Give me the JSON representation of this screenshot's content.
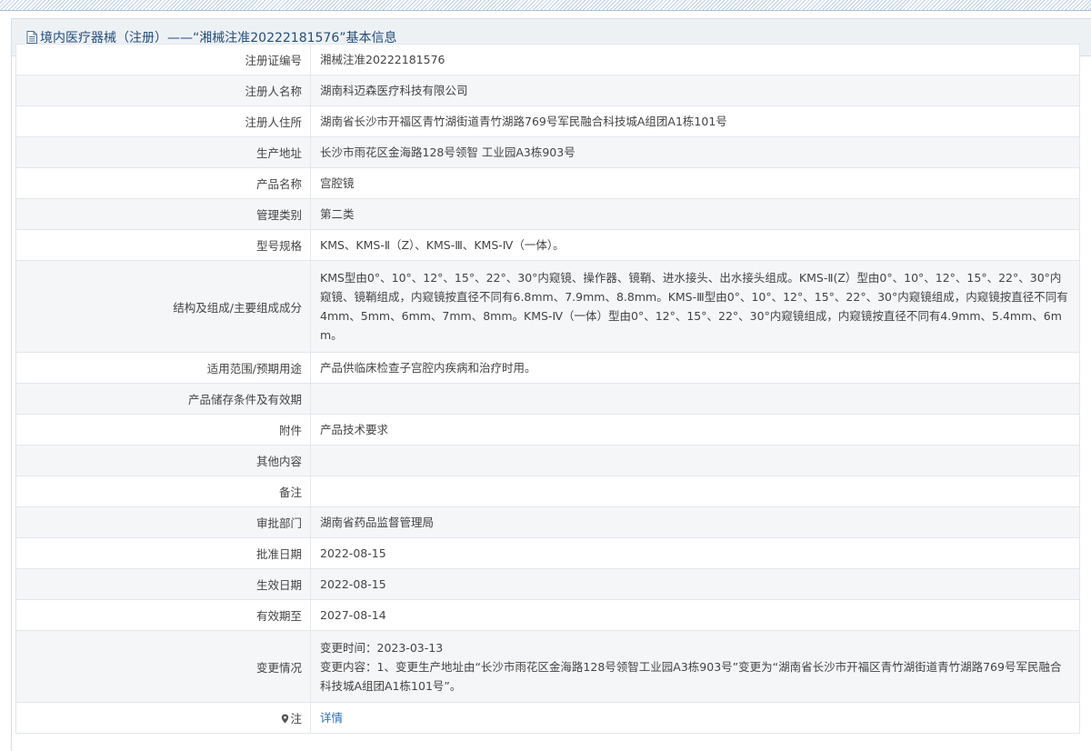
{
  "header": {
    "title": "境内医疗器械（注册）——“湘械注准20222181576”基本信息"
  },
  "rows": [
    {
      "label": "注册证编号",
      "value": "湘械注准20222181576"
    },
    {
      "label": "注册人名称",
      "value": "湖南科迈森医疗科技有限公司"
    },
    {
      "label": "注册人住所",
      "value": "湖南省长沙市开福区青竹湖街道青竹湖路769号军民融合科技城A组团A1栋101号"
    },
    {
      "label": "生产地址",
      "value": "长沙市雨花区金海路128号领智 工业园A3栋903号"
    },
    {
      "label": "产品名称",
      "value": "宫腔镜"
    },
    {
      "label": "管理类别",
      "value": "第二类"
    },
    {
      "label": "型号规格",
      "value": "KMS、KMS-Ⅱ（Z）、KMS-Ⅲ、KMS-Ⅳ（一体）。"
    },
    {
      "label": "结构及组成/主要组成成分",
      "value": "KMS型由0°、10°、12°、15°、22°、30°内窥镜、操作器、镜鞘、进水接头、出水接头组成。KMS-Ⅱ(Z）型由0°、10°、12°、15°、22°、30°内窥镜、镜鞘组成，内窥镜按直径不同有6.8mm、7.9mm、8.8mm。KMS-Ⅲ型由0°、10°、12°、15°、22°、30°内窥镜组成，内窥镜按直径不同有4mm、5mm、6mm、7mm、8mm。KMS-Ⅳ（一体）型由0°、12°、15°、22°、30°内窥镜组成，内窥镜按直径不同有4.9mm、5.4mm、6mm。"
    },
    {
      "label": "适用范围/预期用途",
      "value": "产品供临床检查子宫腔内疾病和治疗时用。"
    },
    {
      "label": "产品储存条件及有效期",
      "value": ""
    },
    {
      "label": "附件",
      "value": "产品技术要求"
    },
    {
      "label": "其他内容",
      "value": ""
    },
    {
      "label": "备注",
      "value": ""
    },
    {
      "label": "审批部门",
      "value": "湖南省药品监督管理局"
    },
    {
      "label": "批准日期",
      "value": "2022-08-15"
    },
    {
      "label": "生效日期",
      "value": "2022-08-15"
    },
    {
      "label": "有效期至",
      "value": "2027-08-14"
    }
  ],
  "change": {
    "label": "变更情况",
    "time": "变更时间：2023-03-13",
    "content": "变更内容：1、变更生产地址由“长沙市雨花区金海路128号领智工业园A3栋903号”变更为“湖南省长沙市开福区青竹湖街道青竹湖路769号军民融合科技城A组团A1栋101号”。"
  },
  "note": {
    "label": "注",
    "icon": "location-pin-icon",
    "link_text": "详情"
  },
  "colors": {
    "header_text": "#244e7a",
    "link": "#2a6cb0",
    "row_alt": "#f5f6f8",
    "border": "#e3e7ec"
  }
}
